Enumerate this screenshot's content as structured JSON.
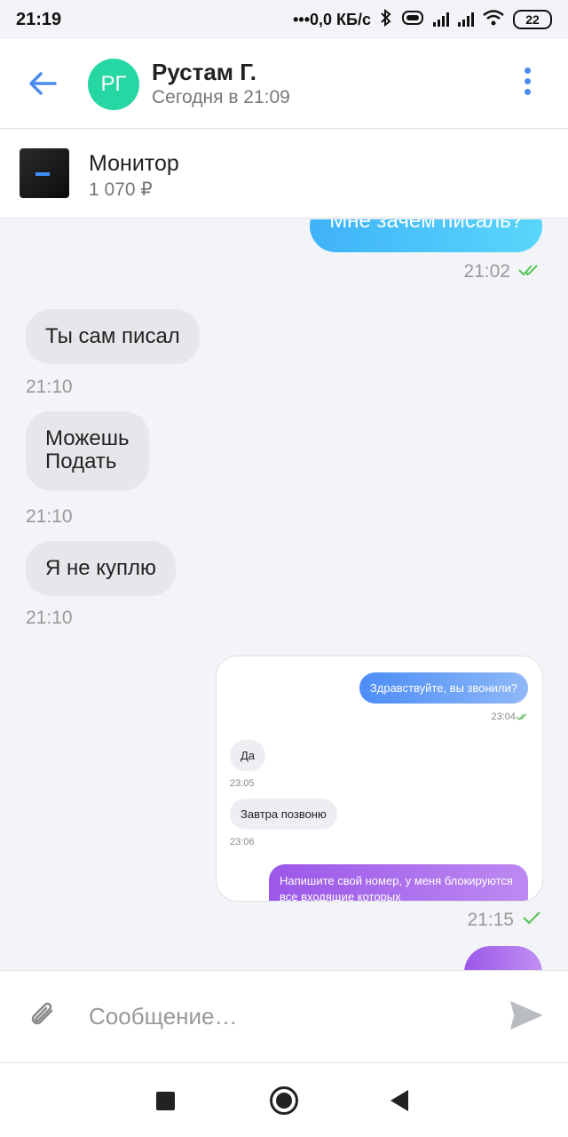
{
  "status_bar": {
    "time": "21:19",
    "network_speed": "•••0,0 КБ/с",
    "battery": "22",
    "icons": [
      "bluetooth-icon",
      "vibrate-icon",
      "signal-icon",
      "signal-icon",
      "wifi-icon",
      "battery-icon"
    ]
  },
  "header": {
    "avatar_initials": "РГ",
    "avatar_color": "#26d7a4",
    "name": "Рустам Г.",
    "last_seen": "Сегодня в 21:09",
    "back_icon": "arrow-left-icon",
    "menu_icon": "more-vertical-icon",
    "accent_color": "#4a8cf0"
  },
  "listing": {
    "title": "Монитор",
    "price": "1 070 ₽"
  },
  "messages": [
    {
      "direction": "out",
      "text": "Мне зачем писаль?",
      "time": "21:02",
      "status": "read"
    },
    {
      "direction": "in",
      "text": "Ты сам писал",
      "time": "21:10"
    },
    {
      "direction": "in",
      "text": "Можешь\nПодать",
      "time": "21:10"
    },
    {
      "direction": "in",
      "text": "Я не куплю",
      "time": "21:10"
    },
    {
      "direction": "out",
      "type": "image",
      "time": "21:15",
      "status": "delivered"
    }
  ],
  "embedded_screenshot": {
    "messages": [
      {
        "direction": "out",
        "text": "Здравствуйте, вы звонили?",
        "time": "23:04"
      },
      {
        "direction": "in",
        "text": "Да",
        "time": "23:05"
      },
      {
        "direction": "in",
        "text": "Завтра позвоню",
        "time": "23:06"
      },
      {
        "direction": "out",
        "text": "Напишите свой номер, у меня блокируются все входящие которых"
      }
    ]
  },
  "input": {
    "placeholder": "Сообщение…",
    "attach_icon": "paperclip-icon",
    "send_icon": "send-icon"
  },
  "colors": {
    "out_bubble": "#3fb2f8",
    "in_bubble": "#e6e7ea",
    "read_check": "#5ac25a",
    "purple_bubble": "#9b57e8"
  }
}
